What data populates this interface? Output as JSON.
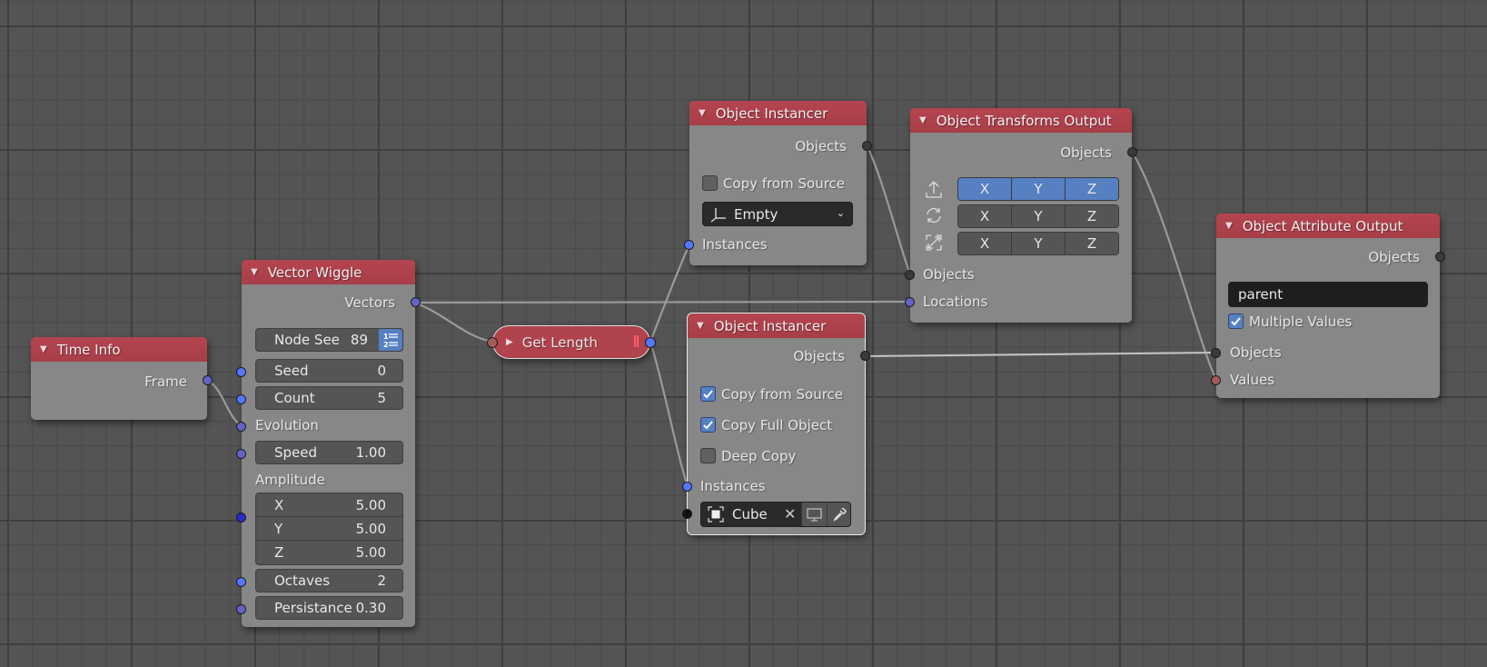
{
  "editor": "Node Editor",
  "nodes": {
    "time_info": {
      "title": "Time Info",
      "outputs": [
        "Frame"
      ]
    },
    "vector_wiggle": {
      "title": "Vector Wiggle",
      "outputs": [
        "Vectors"
      ],
      "node_seed_label": "Node See",
      "node_seed_value": "89",
      "node_seed_icon": "list-numbered-icon",
      "seed": {
        "label": "Seed",
        "value": "0"
      },
      "count": {
        "label": "Count",
        "value": "5"
      },
      "evolution_label": "Evolution",
      "speed": {
        "label": "Speed",
        "value": "1.00"
      },
      "amplitude_label": "Amplitude",
      "amplitude": [
        {
          "label": "X",
          "value": "5.00"
        },
        {
          "label": "Y",
          "value": "5.00"
        },
        {
          "label": "Z",
          "value": "5.00"
        }
      ],
      "octaves": {
        "label": "Octaves",
        "value": "2"
      },
      "persistance": {
        "label": "Persistance",
        "value": "0.30"
      }
    },
    "get_length": {
      "title": "Get Length",
      "collapsed": true
    },
    "object_instancer_1": {
      "title": "Object Instancer",
      "outputs": [
        "Objects"
      ],
      "copy_from_source": {
        "label": "Copy from Source",
        "checked": false
      },
      "object_type": {
        "value": "Empty",
        "icon": "empty-axes-icon"
      },
      "inputs": [
        "Instances"
      ]
    },
    "object_instancer_2": {
      "title": "Object Instancer",
      "selected": true,
      "outputs": [
        "Objects"
      ],
      "copy_from_source": {
        "label": "Copy from Source",
        "checked": true
      },
      "copy_full_object": {
        "label": "Copy Full Object",
        "checked": true
      },
      "deep_copy": {
        "label": "Deep Copy",
        "checked": false
      },
      "inputs": [
        "Instances"
      ],
      "source_object": {
        "value": "Cube",
        "icon": "object-icon"
      }
    },
    "object_transforms_output": {
      "title": "Object Transforms Output",
      "outputs": [
        "Objects"
      ],
      "location_axes": {
        "icon": "location-icon",
        "labels": [
          "X",
          "Y",
          "Z"
        ],
        "enabled": [
          true,
          true,
          true
        ]
      },
      "rotation_axes": {
        "icon": "rotation-icon",
        "labels": [
          "X",
          "Y",
          "Z"
        ],
        "enabled": [
          false,
          false,
          false
        ]
      },
      "scale_axes": {
        "icon": "scale-icon",
        "labels": [
          "X",
          "Y",
          "Z"
        ],
        "enabled": [
          false,
          false,
          false
        ]
      },
      "inputs": [
        "Objects",
        "Locations"
      ]
    },
    "object_attribute_output": {
      "title": "Object Attribute Output",
      "outputs": [
        "Objects"
      ],
      "attribute": "parent",
      "multiple_values": {
        "label": "Multiple Values",
        "checked": true
      },
      "inputs": [
        "Objects",
        "Values"
      ]
    }
  },
  "colors": {
    "header": "#a8404a",
    "node_body": "#878787",
    "background": "#545454",
    "accent_blue": "#5680c2"
  }
}
